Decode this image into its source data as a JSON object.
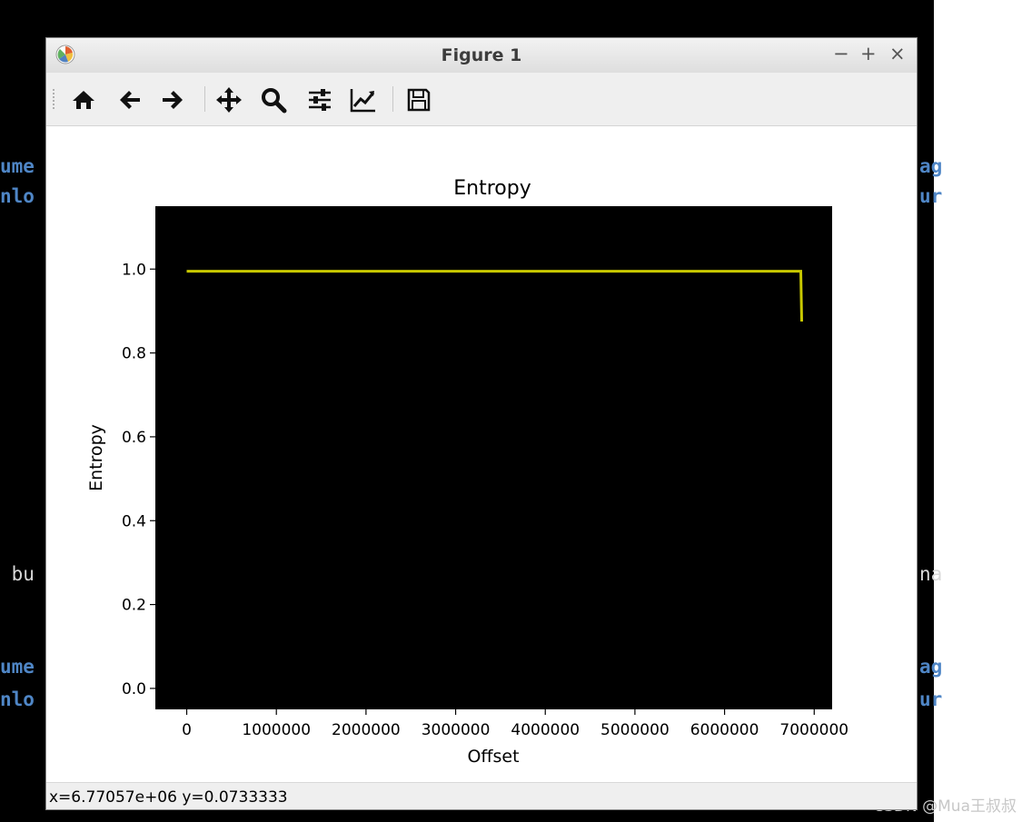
{
  "window": {
    "title": "Figure 1",
    "controls": {
      "minimize": "−",
      "maximize": "+",
      "close": "×"
    }
  },
  "toolbar": {
    "buttons": [
      {
        "name": "home",
        "icon": "home-icon"
      },
      {
        "name": "back",
        "icon": "arrow-left-icon"
      },
      {
        "name": "forward",
        "icon": "arrow-right-icon"
      },
      {
        "name": "pan",
        "icon": "move-icon"
      },
      {
        "name": "zoom",
        "icon": "magnifier-icon"
      },
      {
        "name": "configure-subplots",
        "icon": "sliders-icon"
      },
      {
        "name": "edit-axis",
        "icon": "line-chart-icon"
      },
      {
        "name": "save",
        "icon": "floppy-disk-icon"
      }
    ]
  },
  "status": {
    "coordinates": "x=6.77057e+06 y=0.0733333"
  },
  "background_terminal": {
    "left_fragments": [
      "ume",
      "nlo",
      " bu",
      "ume",
      "nlo"
    ],
    "right_fragments": [
      "ag",
      "ur",
      "na",
      "ag",
      "ur"
    ]
  },
  "watermark": "CSDN @Mua王叔叔",
  "colors": {
    "plot_background": "#000000",
    "line": "#c8c800",
    "terminal_blue": "#4f86c6"
  },
  "chart_data": {
    "type": "line",
    "title": "Entropy",
    "xlabel": "Offset",
    "ylabel": "Entropy",
    "xlim": [
      -350000,
      7200000
    ],
    "ylim": [
      -0.05,
      1.15
    ],
    "xticks": [
      0,
      1000000,
      2000000,
      3000000,
      4000000,
      5000000,
      6000000,
      7000000
    ],
    "xtick_labels": [
      "0",
      "1000000",
      "2000000",
      "3000000",
      "4000000",
      "5000000",
      "6000000",
      "7000000"
    ],
    "yticks": [
      0.0,
      0.2,
      0.4,
      0.6,
      0.8,
      1.0
    ],
    "ytick_labels": [
      "0.0",
      "0.2",
      "0.4",
      "0.6",
      "0.8",
      "1.0"
    ],
    "grid": false,
    "series": [
      {
        "color": "#c8c800",
        "x": [
          0,
          500000,
          1000000,
          2000000,
          3000000,
          4000000,
          5000000,
          6000000,
          6500000,
          6850000,
          6860000
        ],
        "y": [
          0.995,
          0.995,
          0.995,
          0.995,
          0.995,
          0.995,
          0.995,
          0.995,
          0.995,
          0.995,
          0.875
        ]
      }
    ]
  }
}
